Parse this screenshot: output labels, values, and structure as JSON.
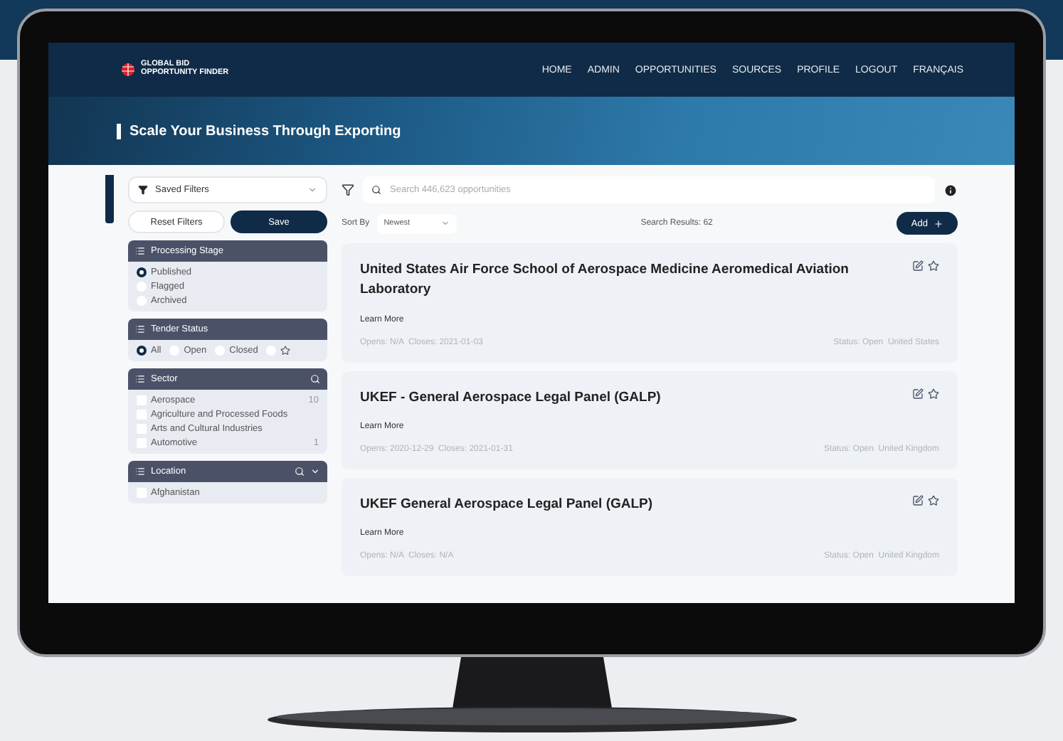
{
  "nav": {
    "logo_lines": [
      "GLOBAL BID",
      "OPPORTUNITY FINDER"
    ],
    "links": [
      {
        "label": "HOME"
      },
      {
        "label": "ADMIN"
      },
      {
        "label": "OPPORTUNITIES"
      },
      {
        "label": "SOURCES"
      },
      {
        "label": "PROFILE"
      },
      {
        "label": "LOGOUT"
      },
      {
        "label": "FRANÇAIS"
      }
    ]
  },
  "hero": {
    "title": "Scale Your Business Through Exporting"
  },
  "sidebar": {
    "saved_filters": "Saved Filters",
    "reset_button": "Reset Filters",
    "save_button": "Save",
    "sections": [
      {
        "title": "Processing Stage",
        "kind": "radio-list",
        "options": [
          {
            "label": "Published",
            "selected": true
          },
          {
            "label": "Flagged",
            "selected": false
          },
          {
            "label": "Archived",
            "selected": false
          }
        ]
      },
      {
        "title": "Tender Status",
        "kind": "radio-row",
        "options": [
          {
            "kind": "text",
            "label": "All",
            "selected": true
          },
          {
            "kind": "text",
            "label": "Open",
            "selected": false
          },
          {
            "kind": "text",
            "label": "Closed",
            "selected": false
          },
          {
            "kind": "starred",
            "selected": false
          }
        ]
      },
      {
        "title": "Sector",
        "kind": "checklist",
        "items": [
          {
            "label": "Aerospace",
            "count": "10",
            "checked": false
          },
          {
            "label": "Agriculture and Processed Foods",
            "checked": false
          },
          {
            "label": "Arts and Cultural Industries",
            "checked": false
          },
          {
            "label": "Automotive",
            "count": "1",
            "checked": false
          }
        ]
      },
      {
        "title": "Location",
        "kind": "checklist",
        "dropdown": true,
        "items": [
          {
            "label": "Afghanistan",
            "checked": false
          }
        ]
      }
    ]
  },
  "main": {
    "search_placeholder": "Search 446,623 opportunities",
    "sort_label": "Sort By",
    "sort_value": "Newest",
    "results": "Search Results: 62",
    "add_button": "Add",
    "cards": [
      {
        "title": "United States Air Force School of Aerospace Medicine Aeromedical Aviation Laboratory",
        "link": "Learn More",
        "dates": "Opens: N/A  Closes: 2021-01-03",
        "status": "Status: Open  United States"
      },
      {
        "title": "UKEF - General Aerospace Legal Panel (GALP)",
        "link": "Learn More",
        "dates": "Opens: 2020-12-29  Closes: 2021-01-31",
        "status": "Status: Open  United Kingdom"
      },
      {
        "title": "UKEF General Aerospace Legal Panel (GALP)",
        "link": "Learn More",
        "dates": "Opens: N/A  Closes: N/A",
        "status": "Status: Open  United Kingdom"
      }
    ]
  }
}
